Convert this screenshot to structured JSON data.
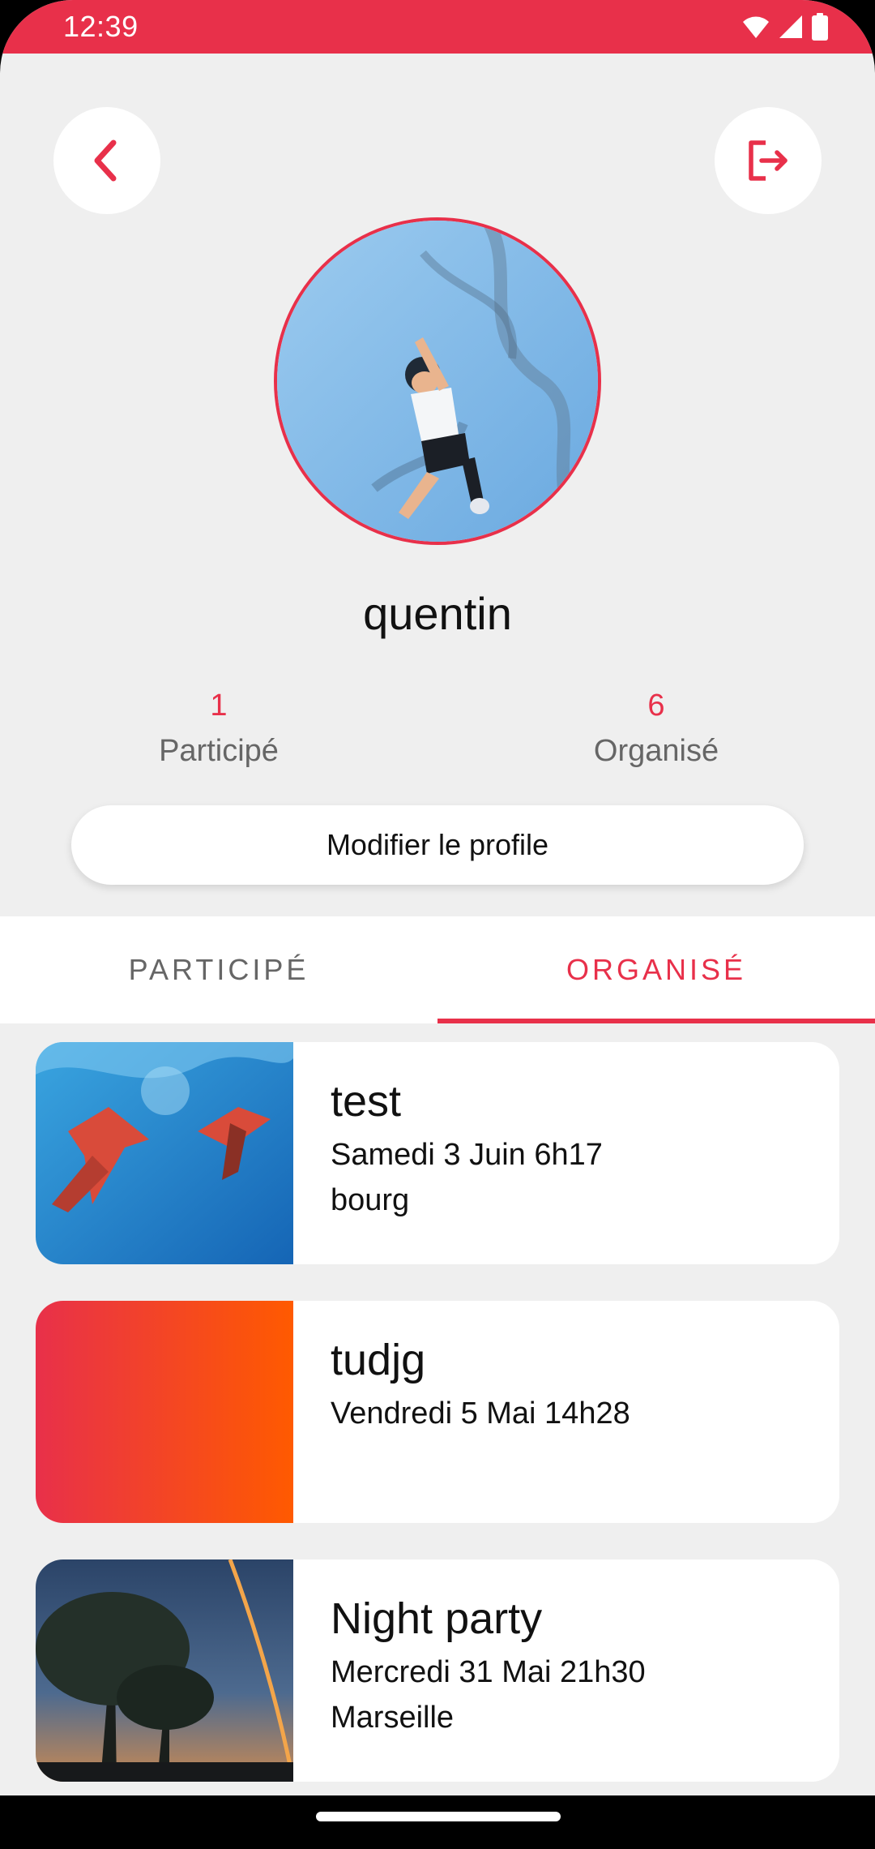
{
  "status_bar": {
    "time": "12:39",
    "color": "#e8304a",
    "icons": [
      "wifi-icon",
      "signal-icon",
      "battery-icon"
    ]
  },
  "header": {
    "back_icon": "chevron-left-icon",
    "logout_icon": "logout-icon"
  },
  "profile": {
    "username": "quentin",
    "stats": [
      {
        "value": "1",
        "label": "Participé"
      },
      {
        "value": "6",
        "label": "Organisé"
      }
    ],
    "edit_button_label": "Modifier le profile"
  },
  "tabs": {
    "items": [
      {
        "label": "PARTICIPÉ",
        "selected": false
      },
      {
        "label": "ORGANISÉ",
        "selected": true
      }
    ]
  },
  "events": [
    {
      "title": "test",
      "date": "Samedi 3 Juin 6h17",
      "place": "bourg"
    },
    {
      "title": "tudjg",
      "date": "Vendredi 5 Mai 14h28",
      "place": ""
    },
    {
      "title": "Night party",
      "date": "Mercredi 31 Mai 21h30",
      "place": "Marseille"
    }
  ],
  "colors": {
    "accent": "#e8304a",
    "background": "#efefef",
    "gradient_start": "#e8304a",
    "gradient_end": "#ff5a00"
  }
}
